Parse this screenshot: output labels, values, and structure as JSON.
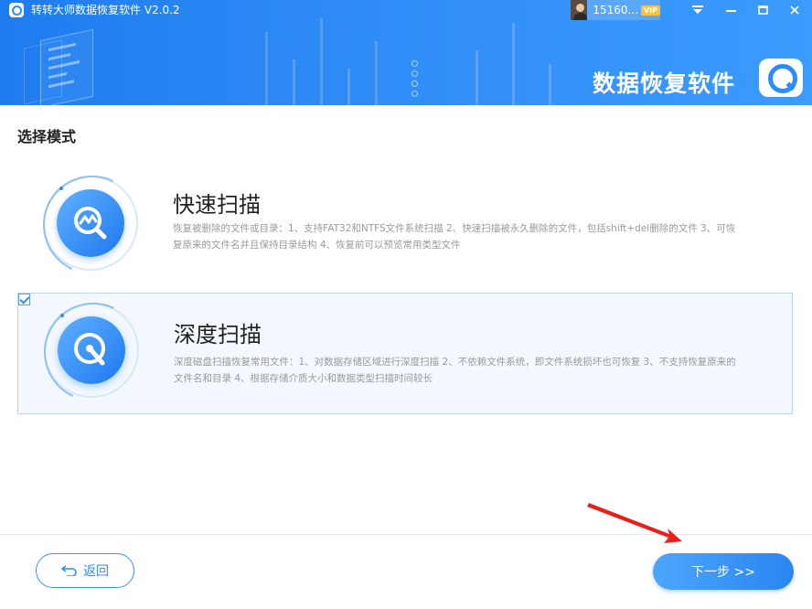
{
  "app": {
    "title": "转转大师数据恢复软件 V2.0.2",
    "brand_text": "数据恢复软件"
  },
  "user": {
    "name": "15160...",
    "vip_label": "VIP"
  },
  "window_controls": [
    "menu-icon",
    "minimize-icon",
    "maximize-icon",
    "close-icon"
  ],
  "main": {
    "section_title": "选择模式",
    "modes": [
      {
        "title": "快速扫描",
        "description": "恢复被删除的文件或目录：1、支持FAT32和NTFS文件系统扫描 2、快速扫描被永久删除的文件，包括shift+del删除的文件 3、可恢复原来的文件名并且保持目录结构 4、恢复前可以预览常用类型文件",
        "icon": "quick-scan-icon",
        "selected": false
      },
      {
        "title": "深度扫描",
        "description": "深度磁盘扫描恢复常用文件：1、对数据存储区域进行深度扫描 2、不依赖文件系统，即文件系统损坏也可恢复 3、不支持恢复原来的文件名和目录 4、根据存储介质大小和数据类型扫描时间较长",
        "icon": "deep-scan-icon",
        "selected": true
      }
    ]
  },
  "footer": {
    "back_label": "返回",
    "next_label": "下一步 >>"
  },
  "colors": {
    "accent": "#2f8cf6",
    "header_start": "#1e7cf0",
    "header_end": "#3b9bff",
    "selected_bg": "#f3f8fe",
    "annotation_arrow": "#e8201c"
  }
}
